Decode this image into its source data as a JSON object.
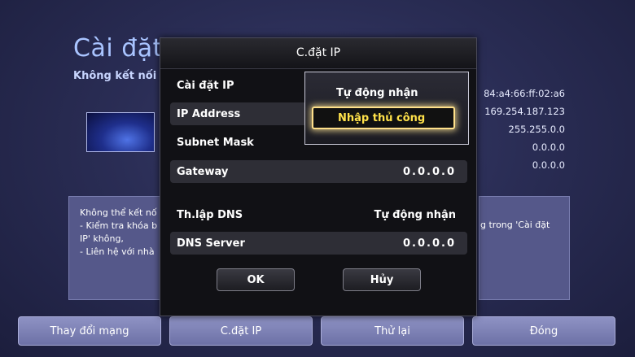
{
  "background": {
    "title": "Cài đặt m",
    "subtitle": "Không kết nối m",
    "values": [
      "84:a4:66:ff:02:a6",
      "169.254.187.123",
      "255.255.0.0",
      "0.0.0.0",
      "0.0.0.0"
    ],
    "message_left": [
      "Không thể kết nố",
      "- Kiểm tra khóa b",
      "IP' không,",
      "- Liên hệ với nhà"
    ],
    "message_right": "g trong 'Cài đặt",
    "bottom_buttons": [
      "Thay đổi mạng",
      "C.đặt IP",
      "Thử lại",
      "Đóng"
    ]
  },
  "dialog": {
    "title": "C.đặt IP",
    "rows": [
      {
        "label": "Cài đặt IP",
        "value": ""
      },
      {
        "label": "IP Address",
        "value": ""
      },
      {
        "label": "Subnet Mask",
        "value": ""
      },
      {
        "label": "Gateway",
        "value": "0.0.0.0"
      },
      {
        "label": "Th.lập DNS",
        "value": "Tự động nhận"
      },
      {
        "label": "DNS Server",
        "value": "0.0.0.0"
      }
    ],
    "ok": "OK",
    "cancel": "Hủy"
  },
  "dropdown": {
    "options": [
      "Tự động nhận",
      "Nhập thủ công"
    ],
    "highlight_color": "#ffe14a"
  }
}
